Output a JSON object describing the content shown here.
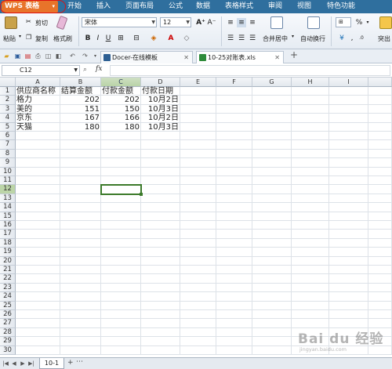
{
  "menubar": {
    "app_label": "WPS 表格",
    "items": [
      "开始",
      "插入",
      "页面布局",
      "公式",
      "数据",
      "表格样式",
      "审阅",
      "视图",
      "特色功能"
    ]
  },
  "ribbon": {
    "paste": "粘贴",
    "cut": "剪切",
    "copy": "复制",
    "format_painter": "格式刷",
    "font_name": "宋体",
    "font_size": "12",
    "bold": "B",
    "italic": "I",
    "underline": "U",
    "merge_center": "合并居中",
    "wrap_text": "自动换行",
    "number_format": "%",
    "more": "突出"
  },
  "tabs": [
    {
      "label": "Docer-在线模板"
    },
    {
      "label": "10-25对账表.xls"
    }
  ],
  "formula_bar": {
    "cell_ref": "C12",
    "fx": "fx",
    "content": ""
  },
  "grid": {
    "columns": [
      "A",
      "B",
      "C",
      "D",
      "E",
      "F",
      "G",
      "H",
      "I"
    ],
    "rows": [
      "1",
      "2",
      "3",
      "4",
      "5",
      "6",
      "7",
      "8",
      "9",
      "10",
      "11",
      "12",
      "13",
      "14",
      "15",
      "16",
      "17",
      "18",
      "19",
      "20",
      "21",
      "22",
      "23",
      "24",
      "25",
      "26",
      "27",
      "28",
      "29",
      "30"
    ],
    "selected_column": "C",
    "selected_row": "12",
    "cells": {
      "A1": "供应商名称",
      "B1": "结算金额",
      "C1": "付款金额",
      "D1": "付款日期",
      "A2": "格力",
      "B2": "202",
      "C2": "202",
      "D2": "10月2日",
      "A3": "美的",
      "B3": "151",
      "C3": "150",
      "D3": "10月3日",
      "A4": "京东",
      "B4": "167",
      "C4": "166",
      "D4": "10月2日",
      "A5": "天猫",
      "B5": "180",
      "C5": "180",
      "D5": "10月3日"
    }
  },
  "sheets": {
    "active": "10-1",
    "add": "+",
    "more": "⋯"
  },
  "watermark": {
    "text": "Bai du 经验",
    "sub": "jingyan.baidu.com"
  },
  "colors": {
    "menubar": "#2f6f9e",
    "wps_button": "#e8742a",
    "selection": "#3b7a2a"
  }
}
